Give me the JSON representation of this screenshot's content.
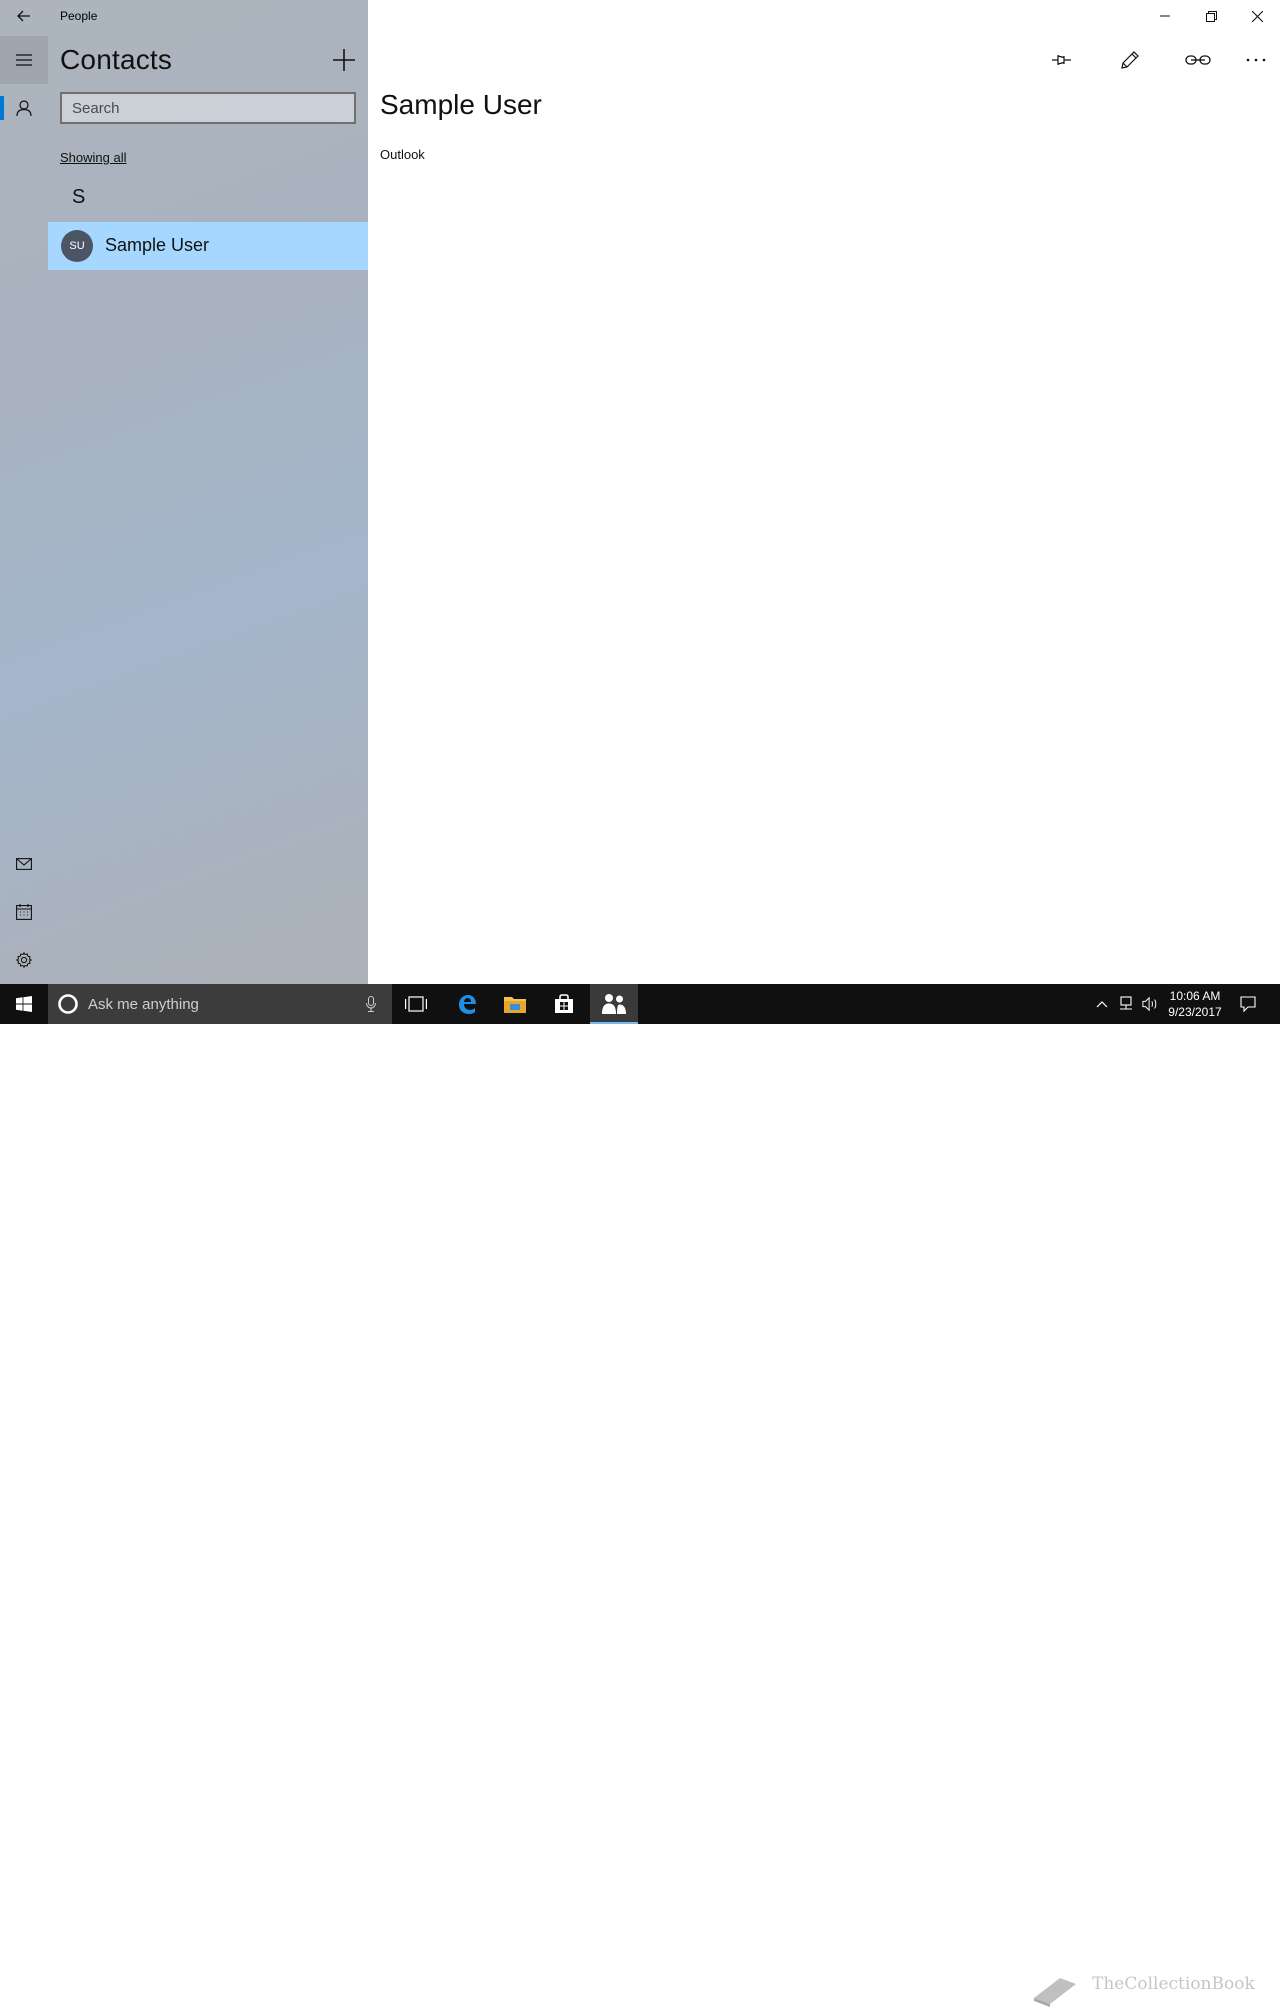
{
  "app": {
    "title": "People"
  },
  "sidebar": {
    "back_icon": "arrow-left-icon",
    "menu_icon": "hamburger-icon",
    "contacts_icon": "person-icon",
    "mail_icon": "mail-icon",
    "calendar_icon": "calendar-icon",
    "settings_icon": "gear-icon"
  },
  "list": {
    "title": "Contacts",
    "search_placeholder": "Search",
    "filter_label": "Showing all",
    "groups": [
      {
        "letter": "S",
        "contacts": [
          {
            "initials": "SU",
            "name": "Sample User",
            "selected": true
          }
        ]
      }
    ]
  },
  "detail": {
    "name": "Sample User",
    "source": "Outlook",
    "commands": [
      "pin-icon",
      "edit-icon",
      "link-icon",
      "more-icon"
    ]
  },
  "window": {
    "controls": [
      "minimize-icon",
      "restore-icon",
      "close-icon"
    ]
  },
  "taskbar": {
    "search_placeholder": "Ask me anything",
    "time": "10:06 AM",
    "date": "9/23/2017",
    "watermark": "TheCollectionBook"
  },
  "colors": {
    "selection": "#a6d8ff",
    "accent": "#0078d7",
    "avatar": "#4b5563"
  }
}
